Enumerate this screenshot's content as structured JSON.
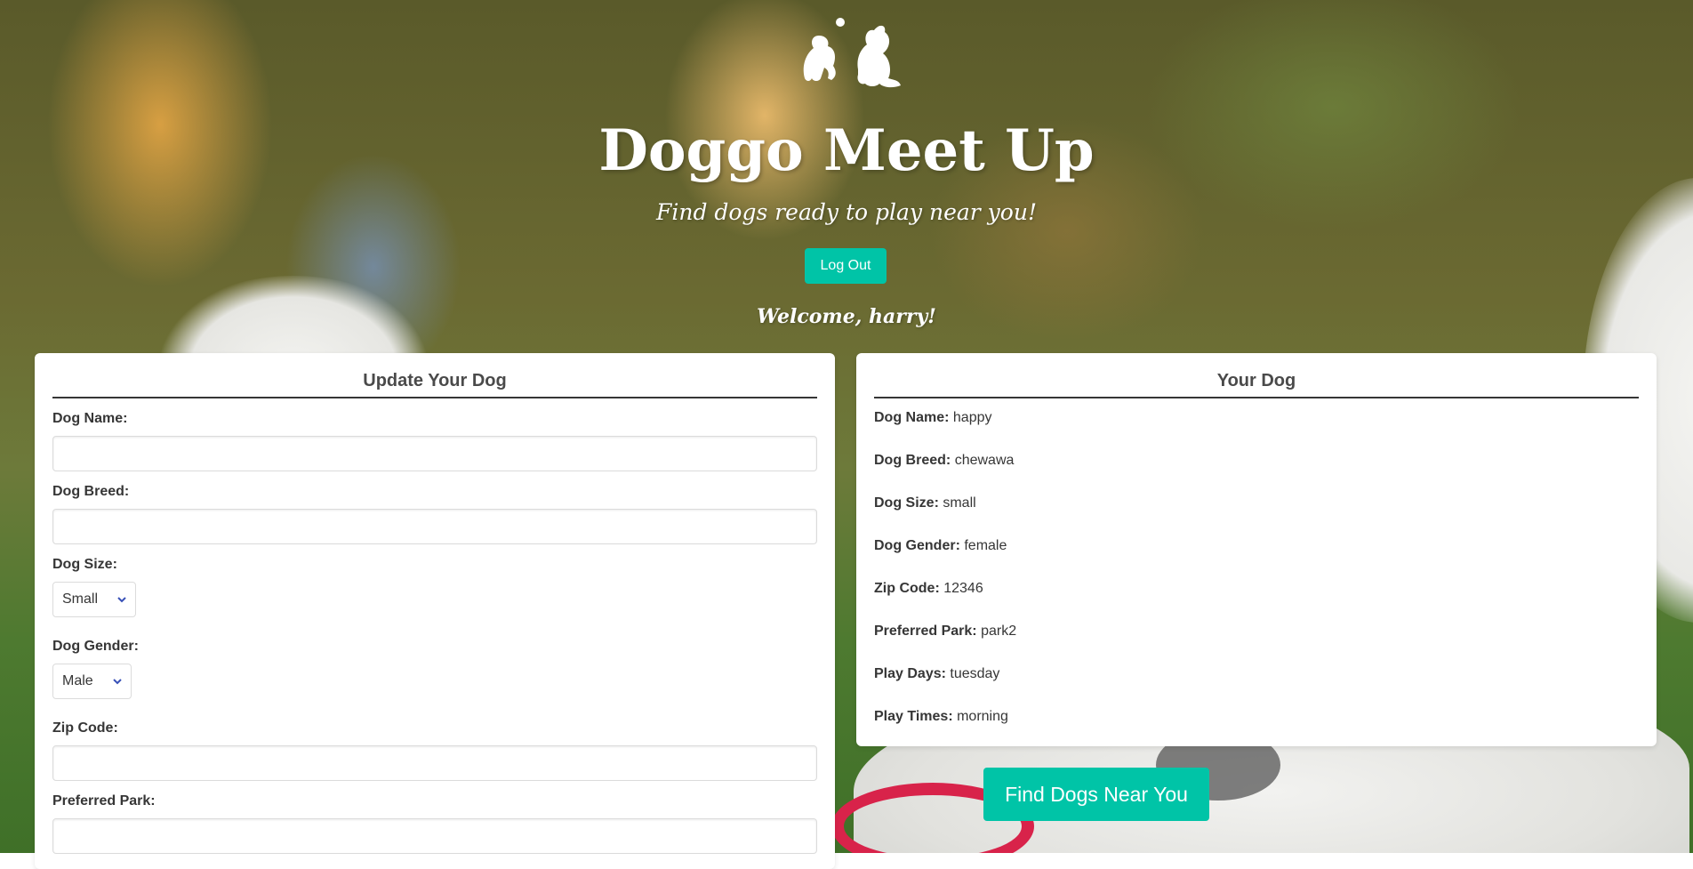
{
  "header": {
    "title": "Doggo Meet Up",
    "subtitle": "Find dogs ready to play near you!",
    "logout_label": "Log Out",
    "welcome": "Welcome, harry!"
  },
  "update_form": {
    "title": "Update Your Dog",
    "dog_name_label": "Dog Name:",
    "dog_name_value": "",
    "dog_breed_label": "Dog Breed:",
    "dog_breed_value": "",
    "dog_size_label": "Dog Size:",
    "dog_size_selected": "Small",
    "dog_gender_label": "Dog Gender:",
    "dog_gender_selected": "Male",
    "zip_label": "Zip Code:",
    "zip_value": "",
    "park_label": "Preferred Park:",
    "park_value": ""
  },
  "your_dog": {
    "title": "Your Dog",
    "rows": [
      {
        "label": "Dog Name:",
        "value": "happy"
      },
      {
        "label": "Dog Breed:",
        "value": "chewawa"
      },
      {
        "label": "Dog Size:",
        "value": "small"
      },
      {
        "label": "Dog Gender:",
        "value": "female"
      },
      {
        "label": "Zip Code:",
        "value": "12346"
      },
      {
        "label": "Preferred Park:",
        "value": "park2"
      },
      {
        "label": "Play Days:",
        "value": "tuesday"
      },
      {
        "label": "Play Times:",
        "value": "morning"
      }
    ]
  },
  "find_button_label": "Find Dogs Near You",
  "icons": {
    "logo": "two-dogs-playing-ball-logo",
    "select_chevron": "chevron-down-icon"
  },
  "colors": {
    "accent": "#00c4a7",
    "chevron": "#3850b7",
    "text": "#363636"
  }
}
